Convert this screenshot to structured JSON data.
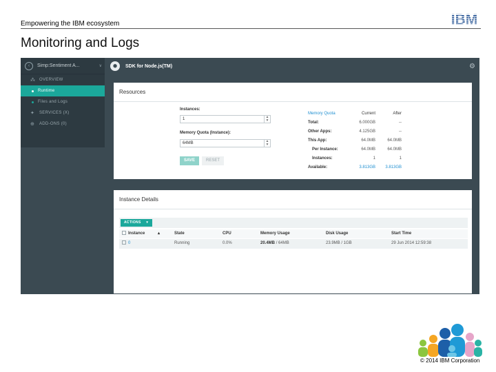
{
  "slide": {
    "header": "Empowering the IBM ecosystem",
    "logo_text": "IBM",
    "title": "Monitoring and Logs",
    "copyright": "© 2014 IBM Corporation"
  },
  "app": {
    "sidebar": {
      "app_name": "Simp:Sentiment A...",
      "chevron": "∨",
      "items": [
        {
          "label": "OVERVIEW",
          "icon": "overview-icon"
        },
        {
          "label": "Runtime",
          "active": true
        },
        {
          "label": "Files and Logs"
        },
        {
          "label": "SERVICES (X)",
          "icon": "services-icon"
        },
        {
          "label": "ADD-ONS (0)",
          "icon": "addons-icon"
        }
      ]
    },
    "topbar": {
      "title": "SDK for Node.js(TM)",
      "gear": "gear-icon"
    },
    "resources": {
      "title": "Resources",
      "instances_label": "Instances:",
      "instances_value": "1",
      "memory_label": "Memory Quota (Instance):",
      "memory_value": "64MB",
      "save_label": "SAVE",
      "reset_label": "RESET",
      "quota": {
        "headers": [
          "Memory Quota",
          "Current",
          "After"
        ],
        "rows": [
          {
            "label": "Total:",
            "current": "6.000GB",
            "after": "--"
          },
          {
            "label": "Other Apps:",
            "current": "4.125GB",
            "after": "--"
          },
          {
            "label": "This App:",
            "current": "64.0MB",
            "after": "64.0MB"
          },
          {
            "label": "Per Instance:",
            "current": "64.0MB",
            "after": "64.0MB"
          },
          {
            "label": "Instances:",
            "current": "1",
            "after": "1"
          },
          {
            "label": "Available:",
            "current": "3.813GB",
            "after": "3.813GB"
          }
        ]
      }
    },
    "instance_details": {
      "title": "Instance Details",
      "actions_label": "ACTIONS",
      "columns": [
        "Instance",
        "State",
        "CPU",
        "Memory Usage",
        "Disk Usage",
        "Start Time"
      ],
      "row": {
        "instance": "0",
        "state": "Running",
        "cpu": "0.0%",
        "memory_used": "20.4MB",
        "memory_total": "/ 64MB",
        "disk": "23.9MB / 1GB",
        "start_time": "29 Jun 2014 12:59:38"
      }
    }
  },
  "colors": {
    "accent": "#1ba89b",
    "link": "#1f8fd1",
    "frame_bg": "#3b4a52",
    "sidebar_bg": "#2d3a41"
  }
}
